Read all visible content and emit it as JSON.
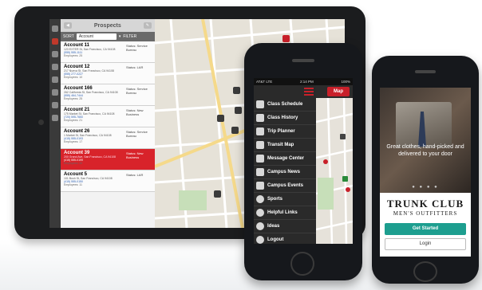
{
  "ipad": {
    "list_title": "Prospects",
    "sort_label": "SORT",
    "sort_value": "Account",
    "filter_label": "FILTER",
    "accounts": [
      {
        "name": "Account 11",
        "address": "123 EXTER St, San Francisco, CA 94108",
        "phone": "(555) 555-1111",
        "employees": "Employees: 25",
        "status": "Status: Service Bureau"
      },
      {
        "name": "Account 12",
        "address": "217 Nueva St, San Francisco, CA 94108",
        "phone": "(555) 277-0227",
        "employees": "Employees: 10",
        "status": "Status: LAR"
      },
      {
        "name": "Account 166",
        "address": "262 California St, San Francisco, CA 94108",
        "phone": "(555) 464-7444",
        "employees": "Employees: 25",
        "status": "Status: Service Bureau"
      },
      {
        "name": "Account 21",
        "address": "175 Market St, San Francisco, CA 94108",
        "phone": "(720) 595-7650",
        "employees": "Employees: 21",
        "status": "Status: New Business"
      },
      {
        "name": "Account 26",
        "address": "1 Market St, San Francisco, CA 94108",
        "phone": "(415) 555-0193",
        "employees": "Employees: 17",
        "status": "Status: Service Bureau"
      },
      {
        "name": "Account 39",
        "address": "200 Grand Ave, San Francisco, CA 94108",
        "phone": "(415) 555-0199",
        "employees": "Employees: 40",
        "status": "Status: New Business"
      },
      {
        "name": "Account 5",
        "address": "101 Bush St, San Francisco, CA 94108",
        "phone": "(415) 555-0150",
        "employees": "Employees: 11",
        "status": "Status: LAR"
      }
    ]
  },
  "phone1": {
    "status_left": "AT&T LTE",
    "status_time": "2:14 PM",
    "status_right": "100%",
    "map_button": "Map",
    "menu": [
      {
        "label": "Class Schedule",
        "icon": "calendar-icon"
      },
      {
        "label": "Class History",
        "icon": "calendar-icon"
      },
      {
        "label": "Trip Planner",
        "icon": "clipboard-icon"
      },
      {
        "label": "Transit Map",
        "icon": "map-icon"
      },
      {
        "label": "Message Center",
        "icon": "envelope-icon"
      },
      {
        "label": "Campus News",
        "icon": "newspaper-icon"
      },
      {
        "label": "Campus Events",
        "icon": "calendar-icon"
      },
      {
        "label": "Sports",
        "icon": "ball-icon"
      },
      {
        "label": "Helpful Links",
        "icon": "link-icon"
      },
      {
        "label": "Ideas",
        "icon": "lightbulb-icon"
      },
      {
        "label": "Logout",
        "icon": "power-icon"
      }
    ]
  },
  "phone2": {
    "tagline": "Great clothes, hand-picked and delivered to your door",
    "brand": "TRUNK CLUB",
    "brand_sub": "MEN'S OUTFITTERS",
    "get_started": "Get Started",
    "login": "Login"
  },
  "colors": {
    "accent_red": "#c8202a",
    "accent_teal": "#1d9e8f"
  }
}
